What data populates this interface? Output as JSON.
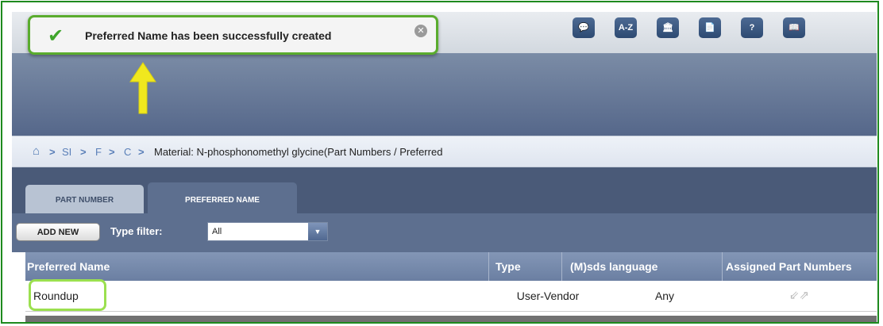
{
  "notification": {
    "message": "Preferred Name has been successfully created",
    "icon": "check-icon",
    "close_glyph": "✕"
  },
  "header_icons": [
    {
      "name": "chat-icon",
      "glyph": "💬"
    },
    {
      "name": "a-z-icon",
      "glyph": "A-Z"
    },
    {
      "name": "building-icon",
      "glyph": "🏛"
    },
    {
      "name": "document-icon",
      "glyph": "📄"
    },
    {
      "name": "help-icon",
      "glyph": "?"
    },
    {
      "name": "book-icon",
      "glyph": "📖"
    }
  ],
  "breadcrumb": {
    "home_icon": "home-icon",
    "separator": ">",
    "items": [
      "SI",
      "F",
      "C"
    ],
    "current": "Material: N-phosphonomethyl glycine(Part Numbers / Preferred"
  },
  "tabs": {
    "part_number": "PART NUMBER",
    "preferred_name": "PREFERRED NAME",
    "active": "preferred_name"
  },
  "toolbar": {
    "add_new": "ADD NEW",
    "type_filter_label": "Type filter:",
    "type_filter_value": "All"
  },
  "table": {
    "columns": [
      "Preferred Name",
      "Type",
      "(M)sds language",
      "Assigned Part Numbers"
    ],
    "rows": [
      {
        "preferred_name": "Roundup",
        "type": "User-Vendor",
        "sds_language": "Any",
        "assigned_icon": "assign-arrows-icon"
      }
    ]
  },
  "colors": {
    "success_green": "#3fa52b",
    "toast_border": "#5aac2e",
    "highlight_arrow": "#f0e81e",
    "header_blue": "#5d6f8f"
  }
}
